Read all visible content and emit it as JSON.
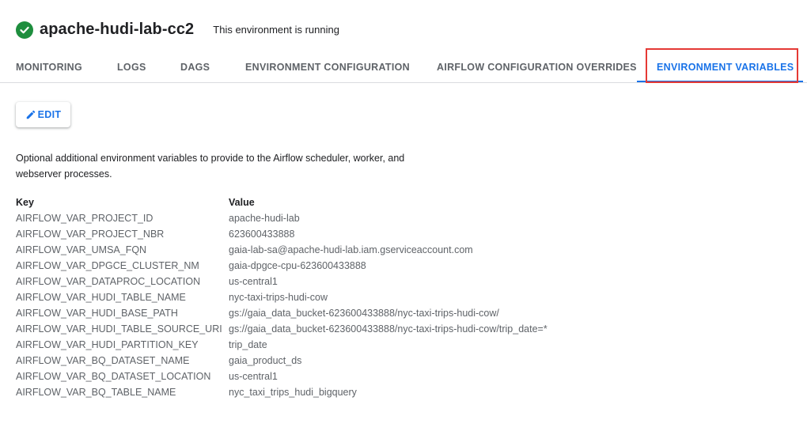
{
  "header": {
    "env_name": "apache-hudi-lab-cc2",
    "status_text": "This environment is running",
    "status_color": "#1e8e3e"
  },
  "tabs": [
    {
      "label": "MONITORING",
      "active": false
    },
    {
      "label": "LOGS",
      "active": false
    },
    {
      "label": "DAGS",
      "active": false
    },
    {
      "label": "ENVIRONMENT CONFIGURATION",
      "active": false
    },
    {
      "label": "AIRFLOW CONFIGURATION OVERRIDES",
      "active": false
    },
    {
      "label": "ENVIRONMENT VARIABLES",
      "active": true
    }
  ],
  "toolbar": {
    "edit_label": "EDIT",
    "edit_icon": "pencil-icon"
  },
  "description": "Optional additional environment variables to provide to the Airflow scheduler, worker, and webserver processes.",
  "variables": {
    "key_header": "Key",
    "value_header": "Value",
    "rows": [
      {
        "key": "AIRFLOW_VAR_PROJECT_ID",
        "value": "apache-hudi-lab"
      },
      {
        "key": "AIRFLOW_VAR_PROJECT_NBR",
        "value": "623600433888"
      },
      {
        "key": "AIRFLOW_VAR_UMSA_FQN",
        "value": "gaia-lab-sa@apache-hudi-lab.iam.gserviceaccount.com"
      },
      {
        "key": "AIRFLOW_VAR_DPGCE_CLUSTER_NM",
        "value": "gaia-dpgce-cpu-623600433888"
      },
      {
        "key": "AIRFLOW_VAR_DATAPROC_LOCATION",
        "value": "us-central1"
      },
      {
        "key": "AIRFLOW_VAR_HUDI_TABLE_NAME",
        "value": "nyc-taxi-trips-hudi-cow"
      },
      {
        "key": "AIRFLOW_VAR_HUDI_BASE_PATH",
        "value": "gs://gaia_data_bucket-623600433888/nyc-taxi-trips-hudi-cow/"
      },
      {
        "key": "AIRFLOW_VAR_HUDI_TABLE_SOURCE_URI",
        "value": "gs://gaia_data_bucket-623600433888/nyc-taxi-trips-hudi-cow/trip_date=*"
      },
      {
        "key": "AIRFLOW_VAR_HUDI_PARTITION_KEY",
        "value": "trip_date"
      },
      {
        "key": "AIRFLOW_VAR_BQ_DATASET_NAME",
        "value": "gaia_product_ds"
      },
      {
        "key": "AIRFLOW_VAR_BQ_DATASET_LOCATION",
        "value": "us-central1"
      },
      {
        "key": "AIRFLOW_VAR_BQ_TABLE_NAME",
        "value": "nyc_taxi_trips_hudi_bigquery"
      }
    ]
  },
  "colors": {
    "accent": "#1a73e8",
    "highlight": "#e53935",
    "tab_inactive": "#5f6368"
  }
}
